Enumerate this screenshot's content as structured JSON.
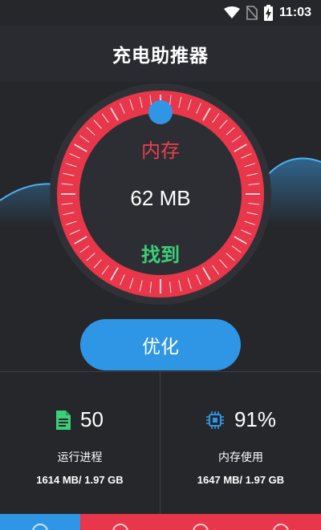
{
  "status_bar": {
    "time": "11:03",
    "icons": [
      "wifi-icon",
      "no-sim-icon",
      "battery-charging-icon"
    ]
  },
  "header": {
    "title": "充电助推器"
  },
  "gauge": {
    "label": "内存",
    "value": "62 MB",
    "status": "找到",
    "ring_color": "#e8374a",
    "knob_color": "#2f96e6",
    "wave_color": "#2f96e6"
  },
  "optimize_button": {
    "label": "优化"
  },
  "stats": {
    "processes": {
      "icon": "document-icon",
      "value": "50",
      "label": "运行进程",
      "detail": "1614 MB/ 1.97 GB"
    },
    "memory": {
      "icon": "chip-icon",
      "value": "91%",
      "label": "内存使用",
      "detail": "1647 MB/ 1.97 GB"
    }
  },
  "bottom_nav": {
    "items": [
      "home-icon",
      "speed-icon",
      "clean-icon",
      "settings-icon"
    ],
    "active_index": 0
  }
}
